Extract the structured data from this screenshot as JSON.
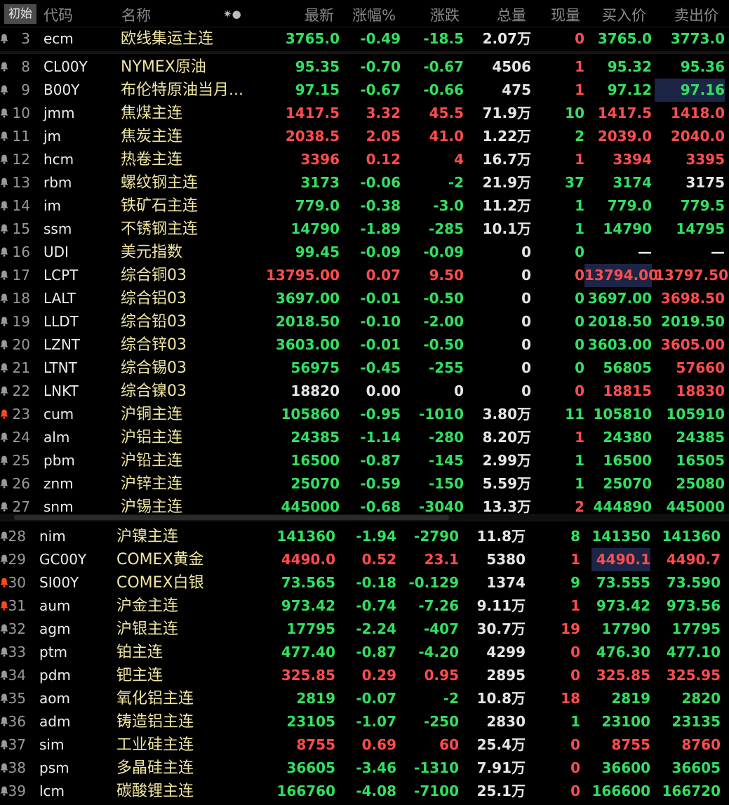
{
  "header": {
    "init": "初始",
    "code": "代码",
    "name": "名称",
    "icon": "✷●",
    "last": "最新",
    "pct": "涨幅%",
    "chg": "涨跌",
    "vol": "总量",
    "now": "现量",
    "bid": "买入价",
    "ask": "卖出价"
  },
  "colors": {
    "up": "#ff4d4d",
    "down": "#33e060",
    "flat": "#e6e6e6",
    "name": "#f0e6a0",
    "bell_active": "#ff4a1a"
  },
  "rows_a": [
    {
      "n": "3",
      "code": "ecm",
      "name": "欧线集运主连",
      "last": "3765.0",
      "pct": "-0.49",
      "chg": "-18.5",
      "vol": "2.07万",
      "now": "0",
      "bid": "3765.0",
      "ask": "3773.0",
      "c": "g",
      "nc": "red",
      "bc": "g",
      "ac": "g"
    },
    {
      "n": "8",
      "code": "CL00Y",
      "name": "NYMEX原油",
      "last": "95.35",
      "pct": "-0.70",
      "chg": "-0.67",
      "vol": "4506",
      "now": "1",
      "bid": "95.32",
      "ask": "95.36",
      "c": "g",
      "nc": "red",
      "bc": "g",
      "ac": "g"
    },
    {
      "n": "9",
      "code": "B00Y",
      "name": "布伦特原油当月...",
      "last": "97.15",
      "pct": "-0.67",
      "chg": "-0.66",
      "vol": "475",
      "now": "1",
      "bid": "97.12",
      "ask": "97.16",
      "c": "g",
      "nc": "red",
      "bc": "g",
      "ac": "g",
      "ahl": true
    },
    {
      "n": "10",
      "code": "jmm",
      "name": "焦煤主连",
      "last": "1417.5",
      "pct": "3.32",
      "chg": "45.5",
      "vol": "71.9万",
      "now": "10",
      "bid": "1417.5",
      "ask": "1418.0",
      "c": "red",
      "nc": "g",
      "bc": "red",
      "ac": "red"
    },
    {
      "n": "11",
      "code": "jm",
      "name": "焦炭主连",
      "last": "2038.5",
      "pct": "2.05",
      "chg": "41.0",
      "vol": "1.22万",
      "now": "2",
      "bid": "2039.0",
      "ask": "2040.0",
      "c": "red",
      "nc": "g",
      "bc": "red",
      "ac": "red"
    },
    {
      "n": "12",
      "code": "hcm",
      "name": "热卷主连",
      "last": "3396",
      "pct": "0.12",
      "chg": "4",
      "vol": "16.7万",
      "now": "1",
      "bid": "3394",
      "ask": "3395",
      "c": "red",
      "nc": "red",
      "bc": "red",
      "ac": "red"
    },
    {
      "n": "13",
      "code": "rbm",
      "name": "螺纹钢主连",
      "last": "3173",
      "pct": "-0.06",
      "chg": "-2",
      "vol": "21.9万",
      "now": "37",
      "bid": "3174",
      "ask": "3175",
      "c": "g",
      "nc": "g",
      "bc": "g",
      "ac": "w"
    },
    {
      "n": "14",
      "code": "im",
      "name": "铁矿石主连",
      "last": "779.0",
      "pct": "-0.38",
      "chg": "-3.0",
      "vol": "11.2万",
      "now": "1",
      "bid": "779.0",
      "ask": "779.5",
      "c": "g",
      "nc": "g",
      "bc": "g",
      "ac": "g"
    },
    {
      "n": "15",
      "code": "ssm",
      "name": "不锈钢主连",
      "last": "14790",
      "pct": "-1.89",
      "chg": "-285",
      "vol": "10.1万",
      "now": "1",
      "bid": "14790",
      "ask": "14795",
      "c": "g",
      "nc": "g",
      "bc": "g",
      "ac": "g"
    },
    {
      "n": "16",
      "code": "UDI",
      "name": "美元指数",
      "last": "99.45",
      "pct": "-0.09",
      "chg": "-0.09",
      "vol": "0",
      "now": "0",
      "bid": "—",
      "ask": "—",
      "c": "g",
      "nc": "g",
      "bc": "w",
      "ac": "w"
    },
    {
      "n": "17",
      "code": "LCPT",
      "name": "综合铜03",
      "last": "13795.00",
      "pct": "0.07",
      "chg": "9.50",
      "vol": "0",
      "now": "0",
      "bid": "13794.00",
      "ask": "13797.50",
      "c": "red",
      "nc": "red",
      "bc": "red",
      "ac": "red",
      "bhl": true
    },
    {
      "n": "18",
      "code": "LALT",
      "name": "综合铝03",
      "last": "3697.00",
      "pct": "-0.01",
      "chg": "-0.50",
      "vol": "0",
      "now": "0",
      "bid": "3697.00",
      "ask": "3698.50",
      "c": "g",
      "nc": "g",
      "bc": "g",
      "ac": "red"
    },
    {
      "n": "19",
      "code": "LLDT",
      "name": "综合铅03",
      "last": "2018.50",
      "pct": "-0.10",
      "chg": "-2.00",
      "vol": "0",
      "now": "0",
      "bid": "2018.50",
      "ask": "2019.50",
      "c": "g",
      "nc": "g",
      "bc": "g",
      "ac": "g"
    },
    {
      "n": "20",
      "code": "LZNT",
      "name": "综合锌03",
      "last": "3603.00",
      "pct": "-0.01",
      "chg": "-0.50",
      "vol": "0",
      "now": "0",
      "bid": "3603.00",
      "ask": "3605.00",
      "c": "g",
      "nc": "g",
      "bc": "g",
      "ac": "red"
    },
    {
      "n": "21",
      "code": "LTNT",
      "name": "综合锡03",
      "last": "56975",
      "pct": "-0.45",
      "chg": "-255",
      "vol": "0",
      "now": "0",
      "bid": "56805",
      "ask": "57660",
      "c": "g",
      "nc": "g",
      "bc": "g",
      "ac": "red"
    },
    {
      "n": "22",
      "code": "LNKT",
      "name": "综合镍03",
      "last": "18820",
      "pct": "0.00",
      "chg": "0",
      "vol": "0",
      "now": "0",
      "bid": "18815",
      "ask": "18830",
      "c": "w",
      "nc": "red",
      "bc": "red",
      "ac": "red"
    },
    {
      "n": "23",
      "code": "cum",
      "name": "沪铜主连",
      "last": "105860",
      "pct": "-0.95",
      "chg": "-1010",
      "vol": "3.80万",
      "now": "11",
      "bid": "105810",
      "ask": "105910",
      "c": "g",
      "nc": "g",
      "bc": "g",
      "ac": "g",
      "bell": true
    },
    {
      "n": "24",
      "code": "alm",
      "name": "沪铝主连",
      "last": "24385",
      "pct": "-1.14",
      "chg": "-280",
      "vol": "8.20万",
      "now": "1",
      "bid": "24380",
      "ask": "24385",
      "c": "g",
      "nc": "red",
      "bc": "g",
      "ac": "g"
    },
    {
      "n": "25",
      "code": "pbm",
      "name": "沪铅主连",
      "last": "16500",
      "pct": "-0.87",
      "chg": "-145",
      "vol": "2.99万",
      "now": "1",
      "bid": "16500",
      "ask": "16505",
      "c": "g",
      "nc": "g",
      "bc": "g",
      "ac": "g"
    },
    {
      "n": "26",
      "code": "znm",
      "name": "沪锌主连",
      "last": "25070",
      "pct": "-0.59",
      "chg": "-150",
      "vol": "5.59万",
      "now": "1",
      "bid": "25070",
      "ask": "25080",
      "c": "g",
      "nc": "g",
      "bc": "g",
      "ac": "g"
    },
    {
      "n": "27",
      "code": "snm",
      "name": "沪锡主连",
      "last": "445000",
      "pct": "-0.68",
      "chg": "-3040",
      "vol": "13.3万",
      "now": "2",
      "bid": "444890",
      "ask": "445000",
      "c": "g",
      "nc": "red",
      "bc": "g",
      "ac": "g"
    }
  ],
  "rows_b": [
    {
      "n": "28",
      "code": "nim",
      "name": "沪镍主连",
      "last": "141360",
      "pct": "-1.94",
      "chg": "-2790",
      "vol": "11.8万",
      "now": "8",
      "bid": "141350",
      "ask": "141360",
      "c": "g",
      "nc": "g",
      "bc": "g",
      "ac": "g"
    },
    {
      "n": "29",
      "code": "GC00Y",
      "name": "COMEX黄金",
      "last": "4490.0",
      "pct": "0.52",
      "chg": "23.1",
      "vol": "5380",
      "now": "1",
      "bid": "4490.1",
      "ask": "4490.7",
      "c": "red",
      "nc": "red",
      "bc": "red",
      "ac": "red",
      "bhl": true
    },
    {
      "n": "30",
      "code": "SI00Y",
      "name": "COMEX白银",
      "last": "73.565",
      "pct": "-0.18",
      "chg": "-0.129",
      "vol": "1374",
      "now": "9",
      "bid": "73.555",
      "ask": "73.590",
      "c": "g",
      "nc": "g",
      "bc": "g",
      "ac": "g",
      "bell": true
    },
    {
      "n": "31",
      "code": "aum",
      "name": "沪金主连",
      "last": "973.42",
      "pct": "-0.74",
      "chg": "-7.26",
      "vol": "9.11万",
      "now": "1",
      "bid": "973.42",
      "ask": "973.56",
      "c": "g",
      "nc": "red",
      "bc": "g",
      "ac": "g",
      "bell": true
    },
    {
      "n": "32",
      "code": "agm",
      "name": "沪银主连",
      "last": "17795",
      "pct": "-2.24",
      "chg": "-407",
      "vol": "30.7万",
      "now": "19",
      "bid": "17790",
      "ask": "17795",
      "c": "g",
      "nc": "red",
      "bc": "g",
      "ac": "g"
    },
    {
      "n": "33",
      "code": "ptm",
      "name": "铂主连",
      "last": "477.40",
      "pct": "-0.87",
      "chg": "-4.20",
      "vol": "4299",
      "now": "0",
      "bid": "476.30",
      "ask": "477.10",
      "c": "g",
      "nc": "red",
      "bc": "g",
      "ac": "g"
    },
    {
      "n": "34",
      "code": "pdm",
      "name": "钯主连",
      "last": "325.85",
      "pct": "0.29",
      "chg": "0.95",
      "vol": "2895",
      "now": "0",
      "bid": "325.85",
      "ask": "325.95",
      "c": "red",
      "nc": "red",
      "bc": "red",
      "ac": "red"
    },
    {
      "n": "35",
      "code": "aom",
      "name": "氧化铝主连",
      "last": "2819",
      "pct": "-0.07",
      "chg": "-2",
      "vol": "10.8万",
      "now": "18",
      "bid": "2819",
      "ask": "2820",
      "c": "g",
      "nc": "red",
      "bc": "g",
      "ac": "g"
    },
    {
      "n": "36",
      "code": "adm",
      "name": "铸造铝主连",
      "last": "23105",
      "pct": "-1.07",
      "chg": "-250",
      "vol": "2830",
      "now": "1",
      "bid": "23100",
      "ask": "23135",
      "c": "g",
      "nc": "g",
      "bc": "g",
      "ac": "g"
    },
    {
      "n": "37",
      "code": "sim",
      "name": "工业硅主连",
      "last": "8755",
      "pct": "0.69",
      "chg": "60",
      "vol": "25.4万",
      "now": "0",
      "bid": "8755",
      "ask": "8760",
      "c": "red",
      "nc": "red",
      "bc": "red",
      "ac": "red"
    },
    {
      "n": "38",
      "code": "psm",
      "name": "多晶硅主连",
      "last": "36605",
      "pct": "-3.46",
      "chg": "-1310",
      "vol": "7.91万",
      "now": "0",
      "bid": "36600",
      "ask": "36605",
      "c": "g",
      "nc": "red",
      "bc": "g",
      "ac": "g"
    },
    {
      "n": "39",
      "code": "lcm",
      "name": "碳酸锂主连",
      "last": "166760",
      "pct": "-4.08",
      "chg": "-7100",
      "vol": "25.1万",
      "now": "0",
      "bid": "166600",
      "ask": "166720",
      "c": "g",
      "nc": "red",
      "bc": "g",
      "ac": "g"
    }
  ]
}
